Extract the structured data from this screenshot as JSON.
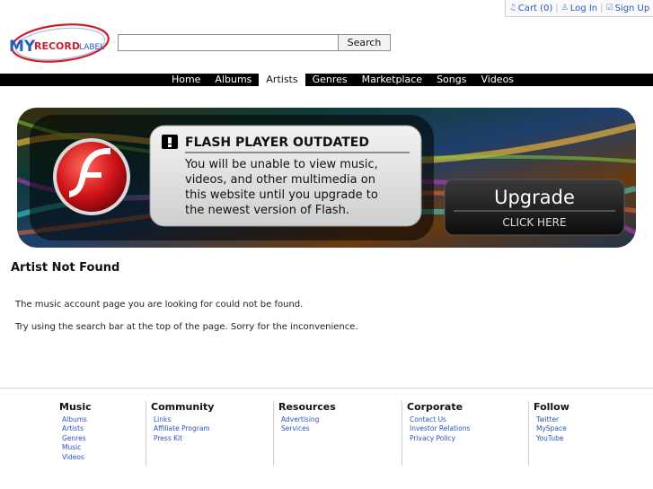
{
  "account": {
    "cart": "Cart (0)",
    "login": "Log In",
    "signup": "Sign Up"
  },
  "logo": {
    "my": "MY",
    "record": "RECORD",
    "label": "LABEL"
  },
  "search": {
    "value": "",
    "button": "Search"
  },
  "nav": [
    "Home",
    "Albums",
    "Artists",
    "Genres",
    "Marketplace",
    "Songs",
    "Videos"
  ],
  "nav_active": "Artists",
  "banner": {
    "heading": "FLASH PLAYER OUTDATED",
    "line1": "You will be unable to view music,",
    "line2": "videos, and other multimedia on",
    "line3": "this website until you upgrade to",
    "line4": "the newest version of Flash.",
    "upgrade": "Upgrade",
    "click": "CLICK HERE"
  },
  "main": {
    "title": "Artist Not Found",
    "message1": "The music account page you are looking for could not be found.",
    "message2": "Try using the search bar at the top of the page. Sorry for the inconvenience."
  },
  "footer": [
    {
      "heading": "Music",
      "links": [
        "Albums",
        "Artists",
        "Genres",
        "Music",
        "Videos"
      ]
    },
    {
      "heading": "Community",
      "links": [
        "Links",
        "Affiliate Program",
        "Press Kit"
      ]
    },
    {
      "heading": "Resources",
      "links": [
        "Advertising",
        "Services"
      ]
    },
    {
      "heading": "Corporate",
      "links": [
        "Contact Us",
        "Investor Relations",
        "Privacy Policy"
      ]
    },
    {
      "heading": "Follow",
      "links": [
        "Twitter",
        "MySpace",
        "YouTube"
      ]
    }
  ],
  "colors": {
    "nav_bg": "#000000",
    "link": "#2a56b8",
    "logo_red": "#cc1f2a",
    "logo_blue": "#2a5fb8"
  }
}
